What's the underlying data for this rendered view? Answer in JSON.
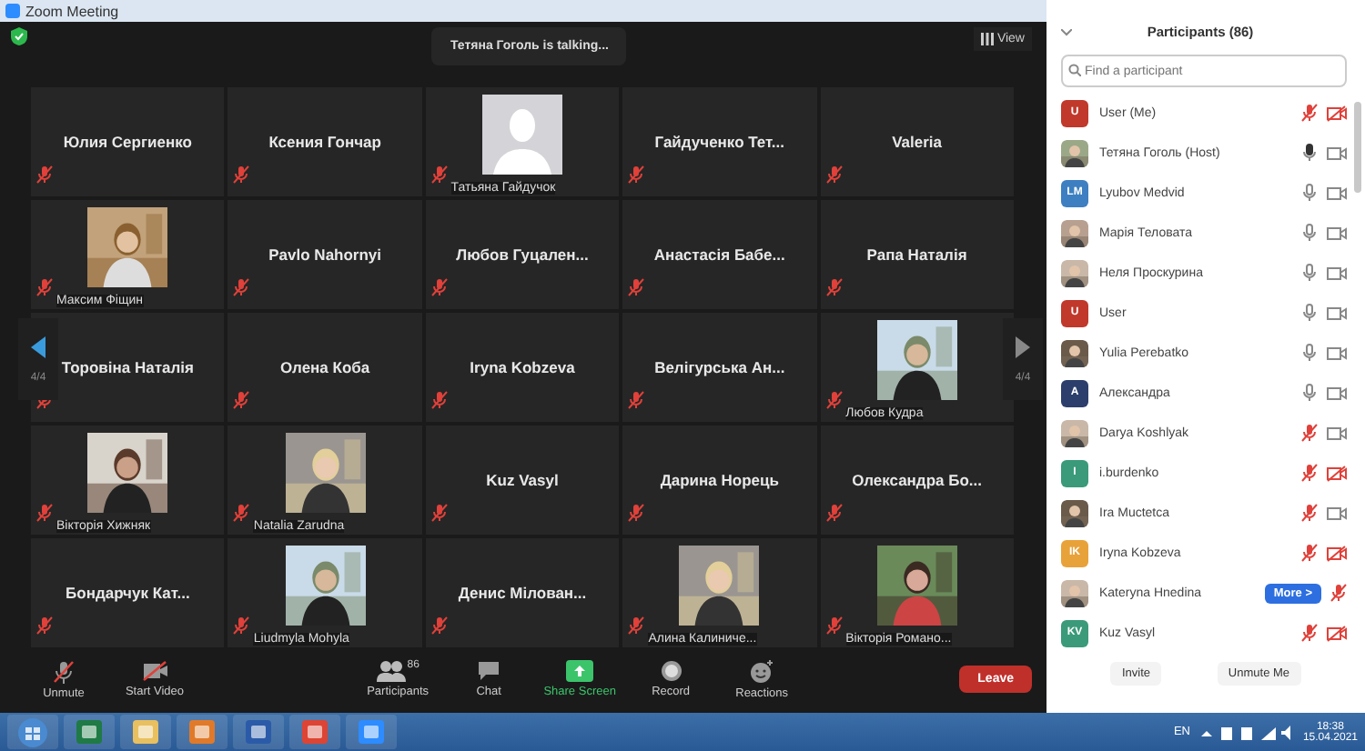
{
  "window": {
    "title": "Zoom Meeting"
  },
  "meeting": {
    "talking": "Тетяна Гоголь is talking...",
    "view_button": "View",
    "pager_left": "4/4",
    "pager_right": "4/4"
  },
  "tiles": [
    {
      "kind": "name",
      "name": "Юлия Сергиенко",
      "mic_muted": true
    },
    {
      "kind": "name",
      "name": "Ксения Гончар",
      "mic_muted": true
    },
    {
      "kind": "avatar",
      "name": "Татьяна Гайдучок",
      "mic_muted": true
    },
    {
      "kind": "name",
      "name": "Гайдученко Тет...",
      "mic_muted": true
    },
    {
      "kind": "name",
      "name": "Valeria",
      "mic_muted": true
    },
    {
      "kind": "picture",
      "name": "Максим Фіщин",
      "mic_muted": true
    },
    {
      "kind": "name",
      "name": "Pavlo Nahornyi",
      "mic_muted": true
    },
    {
      "kind": "name",
      "name": "Любов Гуцален...",
      "mic_muted": true
    },
    {
      "kind": "name",
      "name": "Анастасія Бабе...",
      "mic_muted": true
    },
    {
      "kind": "name",
      "name": "Рапа Наталія",
      "mic_muted": true
    },
    {
      "kind": "name",
      "name": "Торовіна Наталія",
      "mic_muted": true
    },
    {
      "kind": "name",
      "name": "Олена Коба",
      "mic_muted": true
    },
    {
      "kind": "name",
      "name": "Iryna Kobzeva",
      "mic_muted": true
    },
    {
      "kind": "name",
      "name": "Велігурська Ан...",
      "mic_muted": true
    },
    {
      "kind": "picture",
      "name": "Любов Кудра",
      "mic_muted": true
    },
    {
      "kind": "picture",
      "name": "Вікторія Хижняк",
      "mic_muted": true
    },
    {
      "kind": "picture",
      "name": "Natalia Zarudna",
      "mic_muted": true
    },
    {
      "kind": "name",
      "name": "Kuz Vasyl",
      "mic_muted": true
    },
    {
      "kind": "name",
      "name": "Дарина Норець",
      "mic_muted": true
    },
    {
      "kind": "name",
      "name": "Олександра Бо...",
      "mic_muted": true
    },
    {
      "kind": "name",
      "name": "Бондарчук Кат...",
      "mic_muted": true
    },
    {
      "kind": "picture",
      "name": "Liudmyla Mohyla",
      "mic_muted": true
    },
    {
      "kind": "name",
      "name": "Денис Мілован...",
      "mic_muted": true
    },
    {
      "kind": "picture",
      "name": "Алина Калиниче...",
      "mic_muted": true
    },
    {
      "kind": "picture",
      "name": "Вікторія Романо...",
      "mic_muted": true
    }
  ],
  "toolbar": {
    "items": [
      {
        "kind": "mic",
        "label": "Unmute"
      },
      {
        "kind": "video",
        "label": "Start Video"
      },
      {
        "kind": "participants",
        "label": "Participants",
        "count": "86"
      },
      {
        "kind": "chat",
        "label": "Chat"
      },
      {
        "kind": "share",
        "label": "Share Screen"
      },
      {
        "kind": "record",
        "label": "Record"
      },
      {
        "kind": "reactions",
        "label": "Reactions"
      }
    ],
    "leave": "Leave"
  },
  "participants": {
    "title": "Participants (86)",
    "search": {
      "placeholder": "Find a participant"
    },
    "items": [
      {
        "name": "User (Me)",
        "kind": "initials",
        "initials": "U",
        "color": "#c0392b",
        "mic_muted": true,
        "video_off": true
      },
      {
        "name": "Тетяна Гоголь (Host)",
        "mic_muted": false,
        "talking": true,
        "video_off": false
      },
      {
        "name": "Lyubov Medvid",
        "kind": "initials",
        "initials": "LM",
        "color": "#3d7fc1",
        "mic_muted": false,
        "talking": false,
        "video_off": false
      },
      {
        "name": "Марія Теловата",
        "mic_muted": false,
        "talking": false,
        "video_off": false
      },
      {
        "name": "Неля Проскурина",
        "mic_muted": false,
        "talking": false,
        "video_off": false
      },
      {
        "name": "User",
        "kind": "initials",
        "initials": "U",
        "color": "#c0392b",
        "mic_muted": false,
        "talking": false,
        "video_off": false
      },
      {
        "name": "Yulia Perebatko",
        "mic_muted": false,
        "talking": false,
        "video_off": false
      },
      {
        "name": "Александра",
        "kind": "initials",
        "initials": "A",
        "color": "#2c3e6b",
        "mic_muted": false,
        "talking": false,
        "video_off": false
      },
      {
        "name": "Darya Koshlyak",
        "mic_muted": true,
        "video_off": false
      },
      {
        "name": "i.burdenko",
        "kind": "initials",
        "initials": "I",
        "color": "#3a9a7a",
        "mic_muted": true,
        "video_off": true
      },
      {
        "name": "Ira Muctetca",
        "mic_muted": true,
        "video_off": false
      },
      {
        "name": "Iryna Kobzeva",
        "kind": "initials",
        "initials": "IK",
        "color": "#e8a23a",
        "mic_muted": true,
        "video_off": true
      },
      {
        "name": "Kateryna Hnedina",
        "mic_muted": true,
        "more": "More >"
      },
      {
        "name": "Kuz Vasyl",
        "kind": "initials",
        "initials": "KV",
        "color": "#3a9a7a",
        "mic_muted": true,
        "video_off": true
      }
    ],
    "buttons": [
      "Invite",
      "Unmute Me"
    ]
  },
  "taskbar": {
    "language": "EN",
    "time": "18:38",
    "date": "15.04.2021"
  }
}
